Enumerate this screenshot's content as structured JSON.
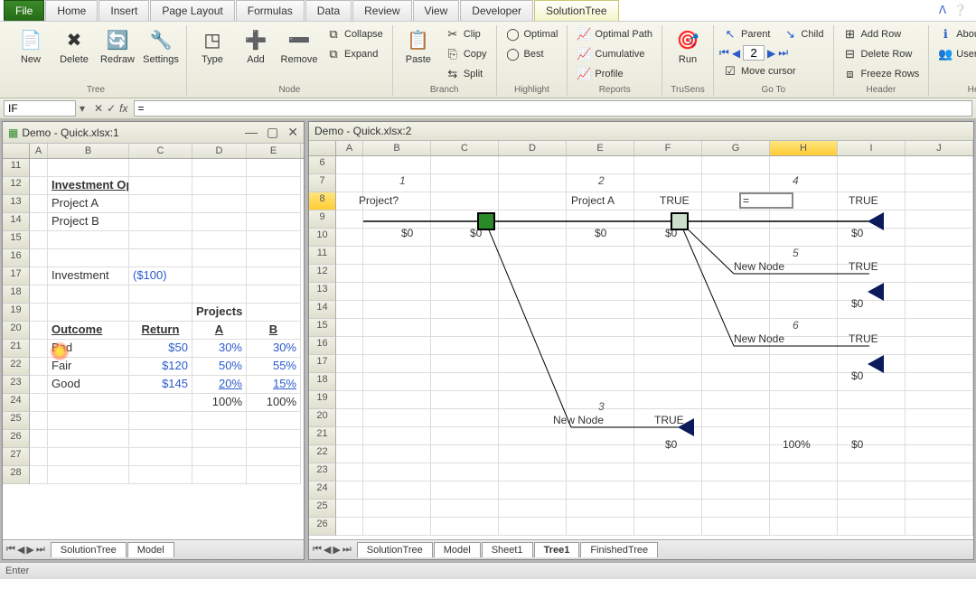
{
  "tabs": {
    "file": "File",
    "home": "Home",
    "insert": "Insert",
    "pagelayout": "Page Layout",
    "formulas": "Formulas",
    "data": "Data",
    "review": "Review",
    "view": "View",
    "developer": "Developer",
    "solutiontree": "SolutionTree"
  },
  "ribbon": {
    "tree": {
      "new": "New",
      "delete": "Delete",
      "redraw": "Redraw",
      "settings": "Settings",
      "title": "Tree"
    },
    "node": {
      "type": "Type",
      "add": "Add",
      "remove": "Remove",
      "collapse": "Collapse",
      "expand": "Expand",
      "title": "Node"
    },
    "branch": {
      "paste": "Paste",
      "clip": "Clip",
      "copy": "Copy",
      "split": "Split",
      "title": "Branch"
    },
    "highlight": {
      "optimal": "Optimal",
      "best": "Best",
      "title": "Highlight"
    },
    "reports": {
      "optpath": "Optimal Path",
      "cumulative": "Cumulative",
      "profile": "Profile",
      "title": "Reports"
    },
    "trusens": {
      "run": "Run",
      "title": "TruSens"
    },
    "goto": {
      "parent": "Parent",
      "child": "Child",
      "num": "2",
      "move": "Move cursor",
      "title": "Go To"
    },
    "header": {
      "addrow": "Add Row",
      "delrow": "Delete Row",
      "freeze": "Freeze Rows",
      "title": "Header"
    },
    "help": {
      "about": "About",
      "guide": "User Guide",
      "title": "Help"
    }
  },
  "formula": {
    "name": "IF",
    "value": "="
  },
  "pane1": {
    "title": "Demo - Quick.xlsx:1",
    "cols": [
      "A",
      "B",
      "C",
      "D",
      "E"
    ],
    "rows": [
      "11",
      "12",
      "13",
      "14",
      "15",
      "16",
      "17",
      "18",
      "19",
      "20",
      "21",
      "22",
      "23",
      "24",
      "25",
      "26",
      "27",
      "28"
    ],
    "data": {
      "b12": "Investment Options",
      "b13": "Project A",
      "b14": "Project B",
      "b17": "Investment",
      "c17": "($100)",
      "d19": "Projects",
      "b20": "Outcome",
      "c20": "Return",
      "d20": "A",
      "e20": "B",
      "b21": "Bad",
      "c21": "$50",
      "d21": "30%",
      "e21": "30%",
      "b22": "Fair",
      "c22": "$120",
      "d22": "50%",
      "e22": "55%",
      "b23": "Good",
      "c23": "$145",
      "d23": "20%",
      "e23": "15%",
      "d24": "100%",
      "e24": "100%"
    },
    "sheets": [
      "SolutionTree",
      "Model"
    ]
  },
  "pane2": {
    "title": "Demo - Quick.xlsx:2",
    "cols": [
      "A",
      "B",
      "C",
      "D",
      "E",
      "F",
      "G",
      "H",
      "I",
      "J"
    ],
    "rows": [
      "6",
      "7",
      "8",
      "9",
      "10",
      "11",
      "12",
      "13",
      "14",
      "15",
      "16",
      "17",
      "18",
      "19",
      "20",
      "21",
      "22",
      "23",
      "24",
      "25",
      "26"
    ],
    "tree": {
      "n1": "1",
      "n2": "2",
      "n3": "3",
      "n4": "4",
      "n5": "5",
      "n6": "6",
      "project_q": "Project?",
      "project_a": "Project A",
      "true": "TRUE",
      "newnode": "New Node",
      "dollar0": "$0",
      "pct100": "100%",
      "editval": "="
    },
    "sheets": [
      "SolutionTree",
      "Model",
      "Sheet1",
      "Tree1",
      "FinishedTree"
    ]
  },
  "status": "Enter"
}
